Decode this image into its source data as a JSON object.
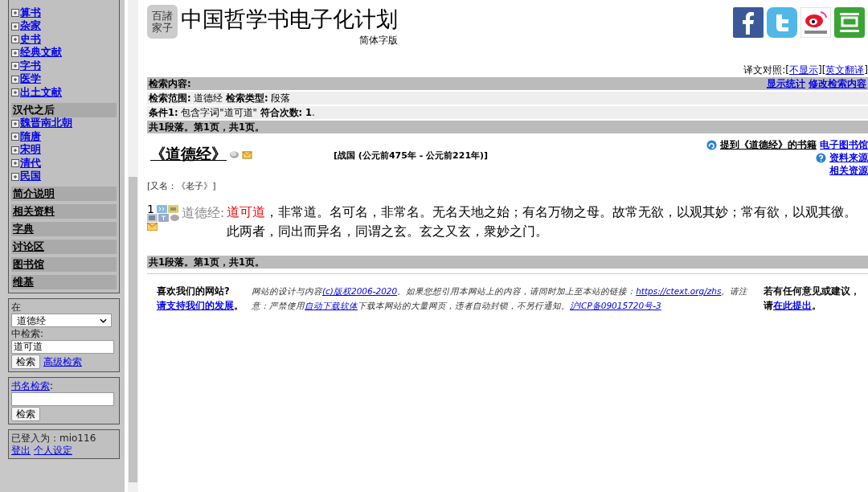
{
  "sidebar": {
    "groups": [
      {
        "items": [
          "算书",
          "杂家",
          "史书",
          "经典文献",
          "字书",
          "医学",
          "出土文献"
        ]
      },
      {
        "heading": "汉代之后",
        "items": [
          "魏晋南北朝",
          "隋唐",
          "宋明",
          "清代",
          "民国"
        ]
      }
    ],
    "sections": [
      "简介说明",
      "相关资料",
      "字典",
      "讨论区",
      "图书馆",
      "维基"
    ],
    "search": {
      "in_label": "在",
      "scope": "道德经",
      "search_label": "中检索:",
      "value": "道可道",
      "button": "检索",
      "advanced": "高级检索"
    },
    "title_search": {
      "label_link": "书名检索",
      "label_rest": ":",
      "button": "检索"
    },
    "login": {
      "text": "已登入为：mio116",
      "links": [
        "登出",
        "个人设定"
      ]
    }
  },
  "header": {
    "logo_lines": [
      "百諸",
      "家子"
    ],
    "title": "中国哲学书电子化计划",
    "subtitle": "简体字版"
  },
  "translation": {
    "label": "译文对照:",
    "links": [
      {
        "open": "[",
        "text": "不显示",
        "close": "]"
      },
      {
        "open": "[",
        "text": "英文翻译",
        "close": "]"
      }
    ]
  },
  "query": {
    "heading": "检索内容:",
    "actions": [
      "显示统计",
      "修改检索内容"
    ],
    "rows": [
      "**检索范围:** 道德经 **检索类型:** 段落",
      "**条件1:** 包含字词\"道可道\" **符合次数:  1**."
    ],
    "summary": "共1段落。第1页，共1页。"
  },
  "book": {
    "title": "《道德经》",
    "period": "[战国 (公元前475年 - 公元前221年)]",
    "mentions": "提到《道德经》的书籍",
    "links": [
      "电子图书馆",
      "资料来源",
      "相关资源"
    ],
    "alias": "[又名：《老子》]"
  },
  "results": [
    {
      "number": "1",
      "source": "道德经:",
      "highlight": "道可道",
      "rest": "，非常道。名可名，非常名。无名天地之始；有名万物之母。故常无欲，以观其妙；常有欲，以观其徼。此两者，同出而异名，同谓之玄。玄之又玄，衆妙之门。"
    }
  ],
  "summary_bottom": "共1段落。第1页，共1页。",
  "footer": {
    "left": [
      {
        "text": "喜欢我们的网站? ",
        "link": false
      },
      {
        "text": "请支持我们的发展",
        "link": true
      },
      {
        "text": "。",
        "link": false
      }
    ],
    "middle": [
      {
        "text": "网站的设计与内容",
        "link": false
      },
      {
        "text": "(c)版权2006-2020",
        "link": true
      },
      {
        "text": "。如果您想引用本网站上的内容，请同时加上至本站的链接：",
        "link": false
      },
      {
        "text": "https://ctext.org/zhs",
        "link": true
      },
      {
        "text": "。请注意：严禁使用",
        "link": false
      },
      {
        "text": "自动下载软体",
        "link": true
      },
      {
        "text": "下载本网站的大量网页，违者自动封锁，不另行通知。",
        "link": false
      },
      {
        "text": "沪ICP备09015720号-3",
        "link": true
      }
    ],
    "right": [
      {
        "text": "若有任何意见或建议，请",
        "link": false
      },
      {
        "text": "在此提出",
        "link": true
      },
      {
        "text": "。",
        "link": false
      }
    ]
  }
}
